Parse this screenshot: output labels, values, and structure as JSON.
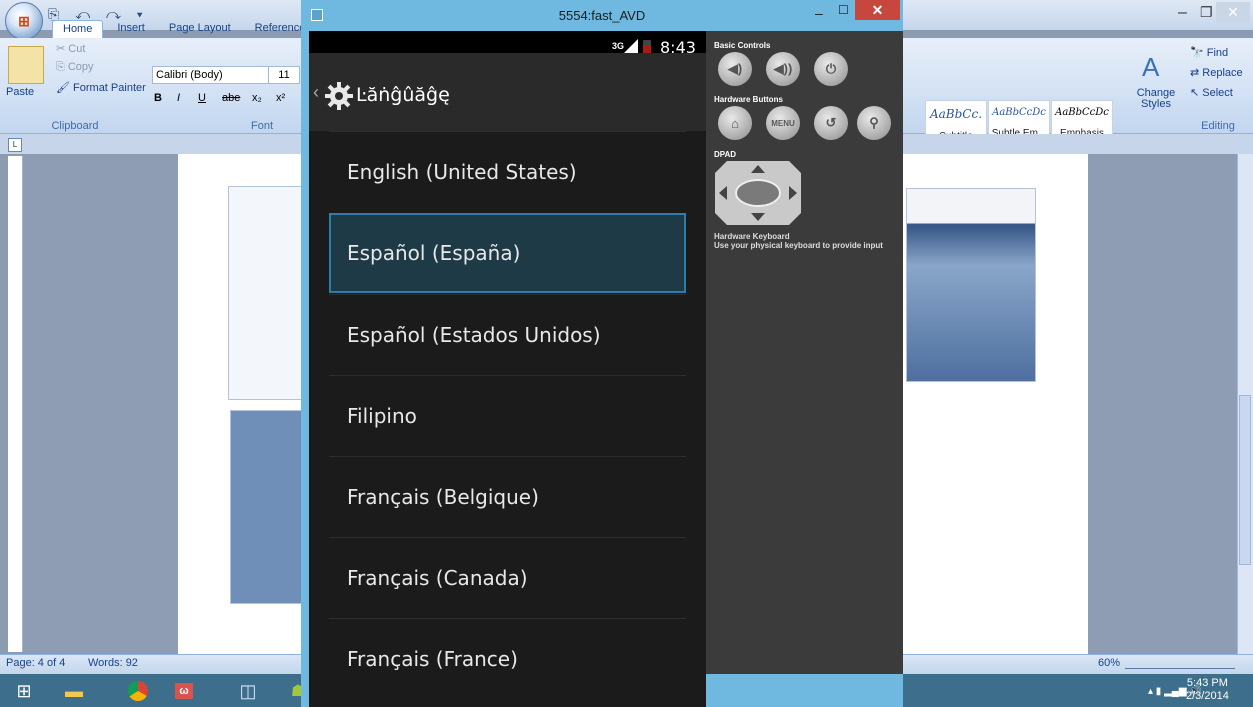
{
  "word": {
    "quick_access": "⎘ ↶ ↷ ▾",
    "tabs": [
      "Home",
      "Insert",
      "Page Layout",
      "Reference"
    ],
    "clipboard": {
      "paste_label": "Paste",
      "cut_label": "Cut",
      "copy_label": "Copy",
      "format_painter_label": "Format Painter",
      "group_label": "Clipboard"
    },
    "font": {
      "font_name": "Calibri (Body)",
      "font_size": "11",
      "group_label": "Font",
      "format_buttons": [
        "B",
        "I",
        "U",
        "abe",
        "x₂",
        "x²"
      ]
    },
    "styles": {
      "items": [
        {
          "preview": "AaBbCc.",
          "label": "Subtitle"
        },
        {
          "preview": "AaBbCcDc",
          "label": "Subtle Em..."
        },
        {
          "preview": "AaBbCcDc",
          "label": "Emphasis"
        }
      ],
      "change_styles_label": "Change Styles",
      "change_styles_glyph": "A"
    },
    "editing": {
      "find_label": "Find",
      "replace_label": "Replace",
      "select_label": "Select",
      "group_label": "Editing"
    },
    "status": {
      "page": "Page: 4 of 4",
      "words": "Words: 92",
      "zoom": "60%"
    }
  },
  "taskbar": {
    "time": "5:43 PM",
    "date": "2/3/2014"
  },
  "emulator": {
    "window_title": "5554:fast_AVD",
    "status": {
      "network": "3G",
      "clock": "8:43"
    },
    "action_bar_title": "Ŀăṅĝûăĝę",
    "languages": [
      "English (United States)",
      "Español (España)",
      "Español (Estados Unidos)",
      "Filipino",
      "Français (Belgique)",
      "Français (Canada)",
      "Français (France)"
    ],
    "selected_index": 1,
    "controls": {
      "basic_controls_label": "Basic Controls",
      "hardware_buttons_label": "Hardware Buttons",
      "menu_label": "MENU",
      "dpad_label": "DPAD",
      "keyboard_label": "Hardware Keyboard",
      "keyboard_hint": "Use your physical keyboard to provide input"
    }
  },
  "colors": {
    "emulator_frame": "#6fb8df",
    "selection_border": "#2a7ea7",
    "taskbar": "#3d6f8c"
  }
}
